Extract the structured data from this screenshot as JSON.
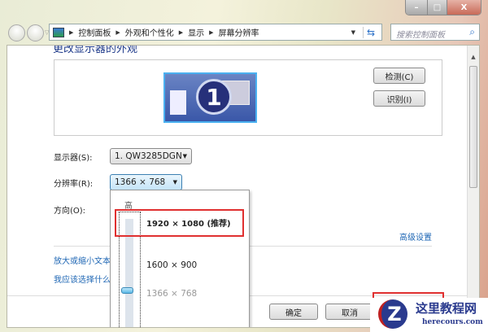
{
  "window": {
    "min": "–",
    "max": "□",
    "close": "X"
  },
  "breadcrumb": [
    "控制面板",
    "外观和个性化",
    "显示",
    "屏幕分辨率"
  ],
  "search": {
    "placeholder": "搜索控制面板"
  },
  "page_title": "更改显示器的外观",
  "preview": {
    "monitor_number": "1",
    "detect": "检测(C)",
    "identify": "识别(I)"
  },
  "display": {
    "label": "显示器(S):",
    "value": "1. QW3285DGN"
  },
  "resolution": {
    "label": "分辨率(R):",
    "value": "1366 × 768",
    "high_label": "高",
    "options": [
      {
        "label": "1920 × 1080 (推荐)"
      },
      {
        "label": "1600 × 900"
      },
      {
        "label": "1366 × 768"
      }
    ]
  },
  "orientation": {
    "label": "方向(O):"
  },
  "links": {
    "advanced": "高级设置",
    "text_size": "放大或缩小文本",
    "help": "我应该选择什么"
  },
  "footer": {
    "ok": "确定",
    "cancel": "取消"
  },
  "watermark": {
    "title": "这里教程网",
    "url": "herecours.com"
  },
  "colors": {
    "highlight": "#e03030",
    "link": "#1e66b4"
  }
}
